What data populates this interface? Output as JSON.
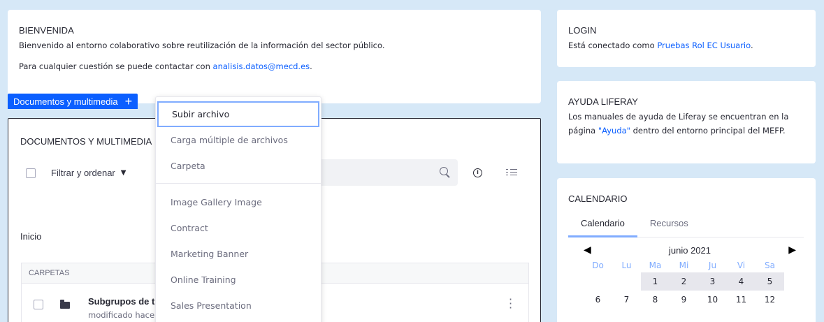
{
  "welcome": {
    "title": "BIENVENIDA",
    "line1": "Bienvenido al entorno colaborativo sobre reutilización de la información del sector público.",
    "line2_prefix": "Para cualquier cuestión se puede contactar con ",
    "email": "analisis.datos@mecd.es",
    "line2_suffix": "."
  },
  "login": {
    "title": "LOGIN",
    "prefix": "Está conectado como ",
    "user": "Pruebas Rol EC Usuario",
    "suffix": "."
  },
  "ayuda": {
    "title": "AYUDA LIFERAY",
    "line1": "Los manuales de ayuda de Liferay se encuentran en la",
    "prefix2": "página ",
    "link": "\"Ayuda\"",
    "suffix2": " dentro del entorno principal del MEFP."
  },
  "calendar": {
    "title": "CALENDARIO",
    "tabs": [
      "Calendario",
      "Recursos"
    ],
    "month": "junio 2021",
    "weekdays": [
      "Do",
      "Lu",
      "Ma",
      "Mi",
      "Ju",
      "Vi",
      "Sa"
    ],
    "week1": [
      "",
      "",
      "1",
      "2",
      "3",
      "4",
      "5"
    ],
    "week2": [
      "6",
      "7",
      "8",
      "9",
      "10",
      "11",
      "12"
    ]
  },
  "docs": {
    "label": "Documentos y multimedia",
    "plus": "+",
    "title": "DOCUMENTOS Y MULTIMEDIA",
    "filter": "Filtrar y ordenar",
    "breadcrumb": "Inicio",
    "section": "CARPETAS",
    "folder_name": "Subgrupos de tr",
    "folder_meta": "modificado hace"
  },
  "menu": {
    "group1": [
      "Subir archivo",
      "Carga múltiple de archivos",
      "Carpeta"
    ],
    "group2": [
      "Image Gallery Image",
      "Contract",
      "Marketing Banner",
      "Online Training",
      "Sales Presentation"
    ]
  }
}
